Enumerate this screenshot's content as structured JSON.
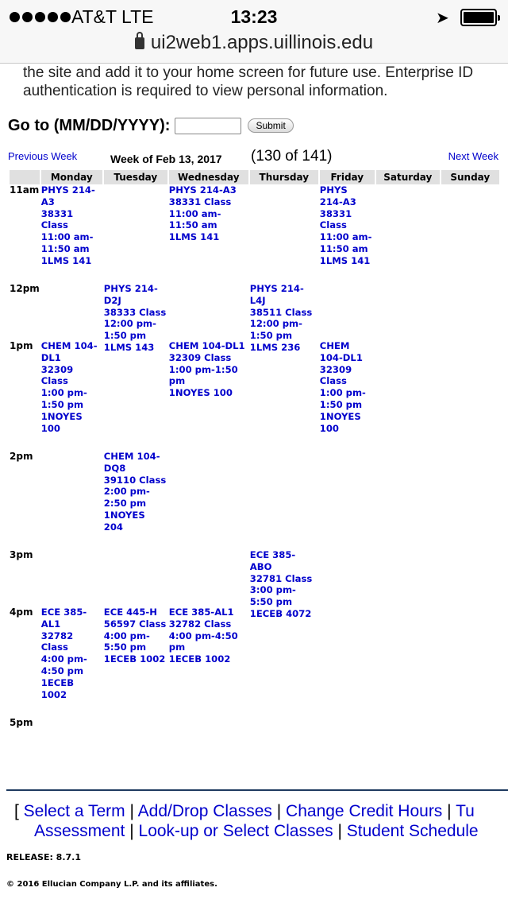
{
  "status_bar": {
    "carrier": "AT&T  LTE",
    "time": "13:23",
    "url": "ui2web1.apps.uillinois.edu"
  },
  "intro": {
    "line1": "the site and add it to your home screen for future use. Enterprise ID",
    "line2": "authentication is required to view personal information."
  },
  "goto": {
    "label": "Go to (MM/DD/YYYY):",
    "input_value": "",
    "button_label": "Submit"
  },
  "week_nav": {
    "previous": "Previous Week",
    "title": "Week of Feb 13, 2017",
    "count": "(130 of 141)",
    "next": "Next Week"
  },
  "schedule": {
    "days": [
      "Monday",
      "Tuesday",
      "Wednesday",
      "Thursday",
      "Friday",
      "Saturday",
      "Sunday"
    ],
    "times": [
      "11am",
      "12pm",
      "1pm",
      "2pm",
      "3pm",
      "4pm",
      "5pm"
    ],
    "cells": {
      "r11_mon": [
        "PHYS 214-",
        "A3",
        "38331",
        "Class",
        "11:00 am-",
        "11:50 am",
        "1LMS 141"
      ],
      "r11_wed": [
        "PHYS 214-A3",
        "38331 Class",
        "11:00 am-",
        "11:50 am",
        "1LMS 141"
      ],
      "r11_fri": [
        "PHYS",
        "214-A3",
        "38331",
        "Class",
        "11:00 am-",
        "11:50 am",
        "1LMS 141"
      ],
      "r12_tue": [
        "PHYS 214-",
        "D2J",
        "38333 Class",
        "12:00 pm-",
        "1:50 pm",
        "1LMS 143"
      ],
      "r12_thu": [
        "PHYS 214-",
        "L4J",
        "38511 Class",
        "12:00 pm-",
        "1:50 pm",
        "1LMS 236"
      ],
      "r1_mon": [
        "CHEM 104-",
        "DL1",
        "32309",
        "Class",
        "1:00 pm-",
        "1:50 pm",
        "1NOYES",
        "100"
      ],
      "r1_wed": [
        "CHEM 104-DL1",
        "32309 Class",
        "1:00 pm-1:50",
        "pm",
        "1NOYES 100"
      ],
      "r1_fri": [
        "CHEM",
        "104-DL1",
        "32309",
        "Class",
        "1:00 pm-",
        "1:50 pm",
        "1NOYES",
        "100"
      ],
      "r2_tue": [
        "CHEM 104-",
        "DQ8",
        "39110 Class",
        "2:00 pm-",
        "2:50 pm",
        "1NOYES",
        "204"
      ],
      "r3_thu": [
        "ECE 385-",
        "ABO",
        "32781 Class",
        "3:00 pm-",
        "5:50 pm",
        "1ECEB 4072"
      ],
      "r4_mon": [
        "ECE 385-",
        "AL1",
        "32782",
        "Class",
        "4:00 pm-",
        "4:50 pm",
        "1ECEB",
        "1002"
      ],
      "r4_tue": [
        "ECE 445-H",
        "56597 Class",
        "4:00 pm-",
        "5:50 pm",
        "1ECEB 1002"
      ],
      "r4_wed": [
        "ECE 385-AL1",
        "32782 Class",
        "4:00 pm-4:50",
        "pm",
        "1ECEB 1002"
      ]
    }
  },
  "footer": {
    "links": [
      "Select a Term",
      "Add/Drop Classes",
      "Change Credit Hours",
      "Tuition Assessment",
      "Look-up or Select Classes",
      "Student Schedule"
    ],
    "link_line1_4_visible": "Tu",
    "link_line2_first": "Assessment",
    "release": "RELEASE: 8.7.1",
    "copyright": "© 2016 Ellucian Company L.P. and its affiliates."
  }
}
